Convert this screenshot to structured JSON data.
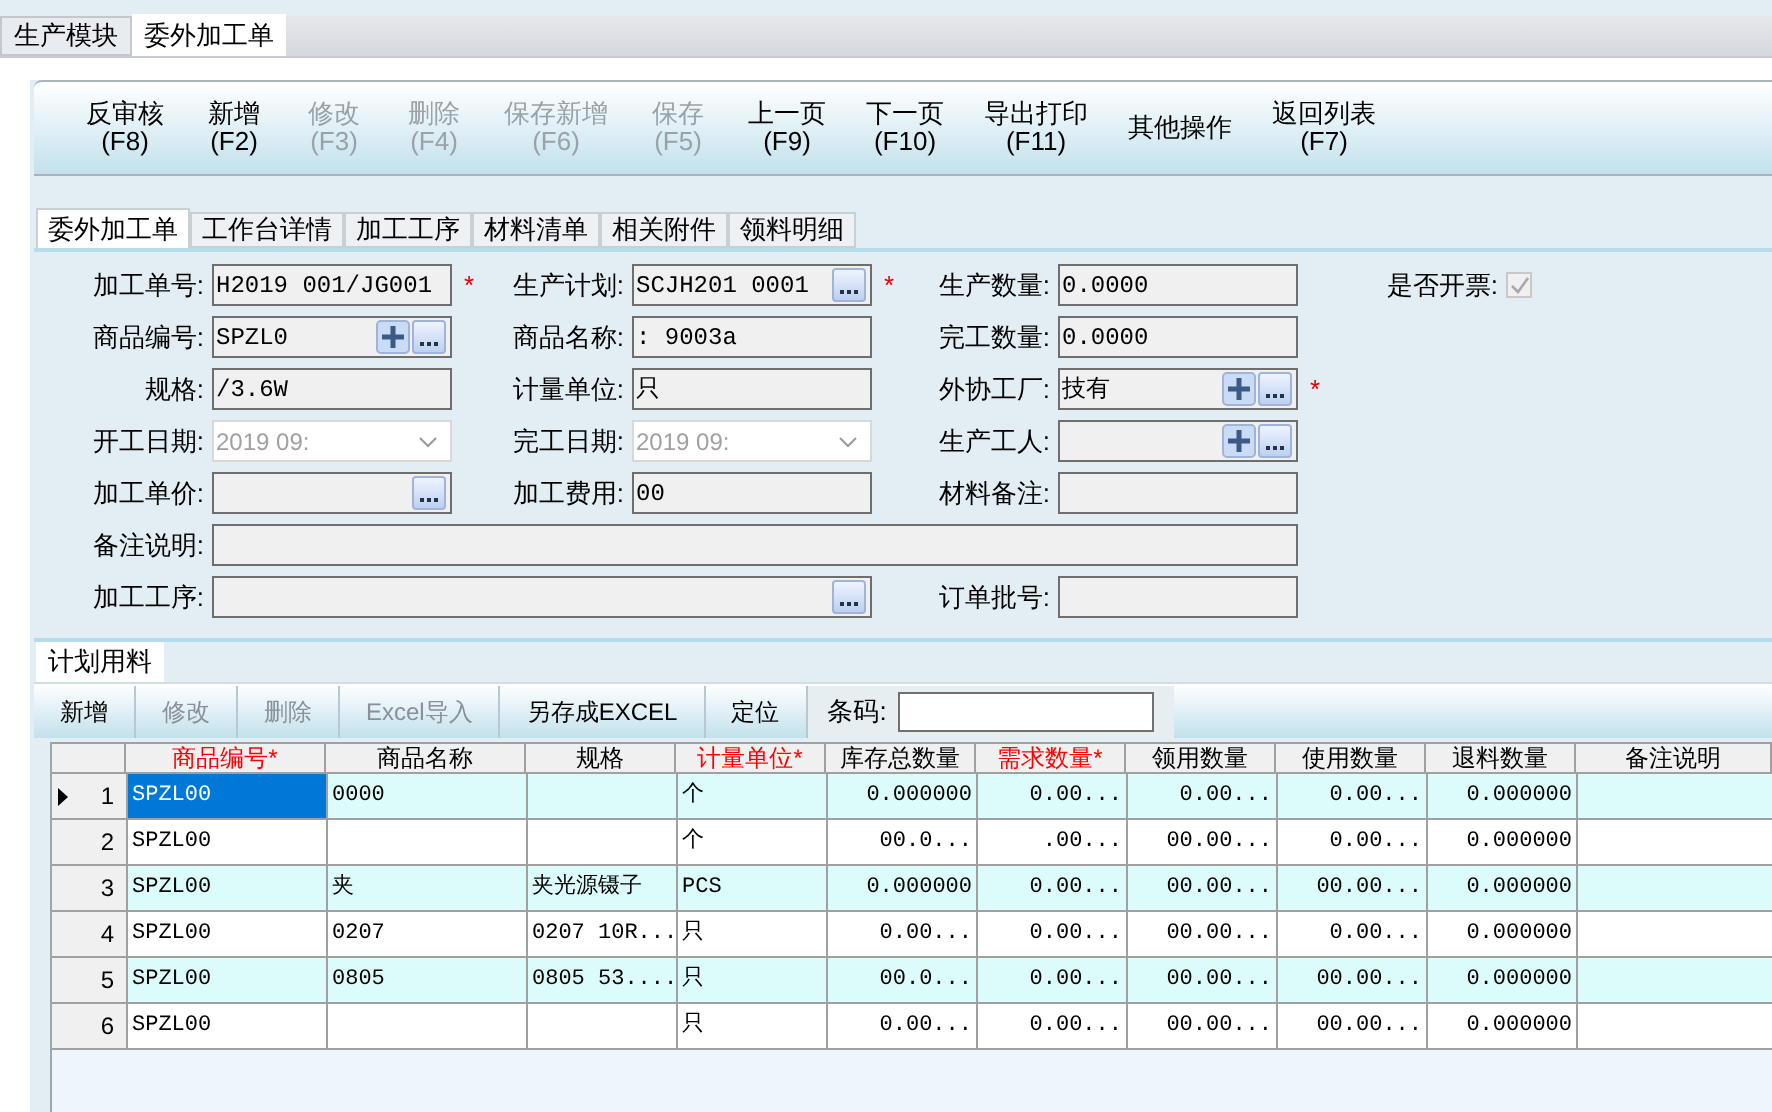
{
  "module_tabs": [
    {
      "label": "生产模块",
      "selected": false
    },
    {
      "label": "委外加工单",
      "selected": true
    }
  ],
  "toolbar": [
    {
      "label": "反审核",
      "shortcut": "(F8)",
      "disabled": false
    },
    {
      "label": "新增",
      "shortcut": "(F2)",
      "disabled": false
    },
    {
      "label": "修改",
      "shortcut": "(F3)",
      "disabled": true
    },
    {
      "label": "删除",
      "shortcut": "(F4)",
      "disabled": true
    },
    {
      "label": "保存新增",
      "shortcut": "(F6)",
      "disabled": true
    },
    {
      "label": "保存",
      "shortcut": "(F5)",
      "disabled": true
    },
    {
      "label": "上一页",
      "shortcut": "(F9)",
      "disabled": false
    },
    {
      "label": "下一页",
      "shortcut": "(F10)",
      "disabled": false
    },
    {
      "label": "导出打印",
      "shortcut": "(F11)",
      "disabled": false
    },
    {
      "label": "其他操作",
      "disabled": false
    },
    {
      "label": "返回列表",
      "shortcut": "(F7)",
      "disabled": false
    }
  ],
  "detail_tabs": [
    {
      "label": "委外加工单",
      "selected": true
    },
    {
      "label": "工作台详情",
      "selected": false
    },
    {
      "label": "加工工序",
      "selected": false
    },
    {
      "label": "材料清单",
      "selected": false
    },
    {
      "label": "相关附件",
      "selected": false
    },
    {
      "label": "领料明细",
      "selected": false
    }
  ],
  "form": {
    "field_lines": [
      [
        {
          "label": "加工单号:",
          "kind": "text",
          "value": "H2019 001/JG001",
          "required_mark": "*"
        },
        {
          "label": "生产计划:",
          "kind": "lookup",
          "value": "SCJH201 0001",
          "required_mark": "*"
        },
        {
          "label": "生产数量:",
          "kind": "text",
          "value": "0.0000"
        },
        {
          "label": "是否开票:",
          "kind": "checkbox",
          "checked": true
        }
      ],
      [
        {
          "label": "商品编号:",
          "kind": "add_lookup",
          "value": "SPZL0"
        },
        {
          "label": "商品名称:",
          "kind": "text",
          "value": ": 9003a"
        },
        {
          "label": "完工数量:",
          "kind": "text",
          "value": "0.0000"
        }
      ],
      [
        {
          "label": "规格:",
          "kind": "text",
          "value": "/3.6W"
        },
        {
          "label": "计量单位:",
          "kind": "text",
          "value": "只"
        },
        {
          "label": "外协工厂:",
          "kind": "add_lookup",
          "value": "技有",
          "required_mark": "*"
        }
      ],
      [
        {
          "label": "开工日期:",
          "kind": "date",
          "value": "2019 09:",
          "disabled": true
        },
        {
          "label": "完工日期:",
          "kind": "date",
          "value": "2019 09:",
          "disabled": true
        },
        {
          "label": "生产工人:",
          "kind": "add_lookup"
        }
      ],
      [
        {
          "label": "加工单价:",
          "kind": "lookup"
        },
        {
          "label": "加工费用:",
          "kind": "text",
          "value": "00"
        },
        {
          "label": "材料备注:",
          "kind": "text"
        }
      ],
      [
        {
          "label": "备注说明:",
          "kind": "wide_text"
        }
      ],
      [
        {
          "label": "加工工序:",
          "kind": "wide_lookup"
        },
        {
          "label": "订单批号:",
          "kind": "text"
        }
      ]
    ]
  },
  "materials": {
    "tab": {
      "label": "计划用料",
      "selected": true
    },
    "toolbar": [
      {
        "label": "新增",
        "disabled": false
      },
      {
        "label": "修改",
        "disabled": true
      },
      {
        "label": "删除",
        "disabled": true
      },
      {
        "label": "Excel导入",
        "disabled": true
      },
      {
        "label": "另存成EXCEL",
        "disabled": false
      },
      {
        "label": "定位",
        "disabled": false
      }
    ],
    "barcode": {
      "label": "条码:"
    },
    "columns": [
      {
        "label": "商品编号*",
        "required": true
      },
      {
        "label": "商品名称",
        "required": false
      },
      {
        "label": "规格",
        "required": false
      },
      {
        "label": "计量单位*",
        "required": true
      },
      {
        "label": "库存总数量",
        "required": false
      },
      {
        "label": "需求数量*",
        "required": true
      },
      {
        "label": "领用数量",
        "required": false
      },
      {
        "label": "使用数量",
        "required": false
      },
      {
        "label": "退料数量",
        "required": false
      },
      {
        "label": "备注说明",
        "required": false
      }
    ],
    "rows": [
      {
        "number": "1",
        "current": true,
        "cells": [
          "SPZL00",
          "0000",
          "",
          "个",
          "0.000000",
          "0.00...",
          "0.00...",
          "0.00...",
          "0.000000",
          ""
        ]
      },
      {
        "number": "2",
        "current": false,
        "cells": [
          "SPZL00",
          "",
          "",
          "个",
          "00.0...",
          ".00...",
          "00.00...",
          "0.00...",
          "0.000000",
          ""
        ]
      },
      {
        "number": "3",
        "current": false,
        "cells": [
          "SPZL00",
          "夹",
          "夹光源镊子",
          "PCS",
          "0.000000",
          "0.00...",
          "00.00...",
          "00.00...",
          "0.000000",
          ""
        ]
      },
      {
        "number": "4",
        "current": false,
        "cells": [
          "SPZL00",
          "0207",
          "0207 10R...",
          "只",
          "0.00...",
          "0.00...",
          "00.00...",
          "0.00...",
          "0.000000",
          ""
        ]
      },
      {
        "number": "5",
        "current": false,
        "cells": [
          "SPZL00",
          "0805",
          "0805 53....",
          "只",
          "00.0...",
          "0.00...",
          "00.00...",
          "00.00...",
          "0.000000",
          ""
        ]
      },
      {
        "number": "6",
        "current": false,
        "cells": [
          "SPZL00",
          "",
          "",
          "只",
          "0.00...",
          "0.00...",
          "00.00...",
          "00.00...",
          "0.000000",
          ""
        ]
      }
    ]
  }
}
